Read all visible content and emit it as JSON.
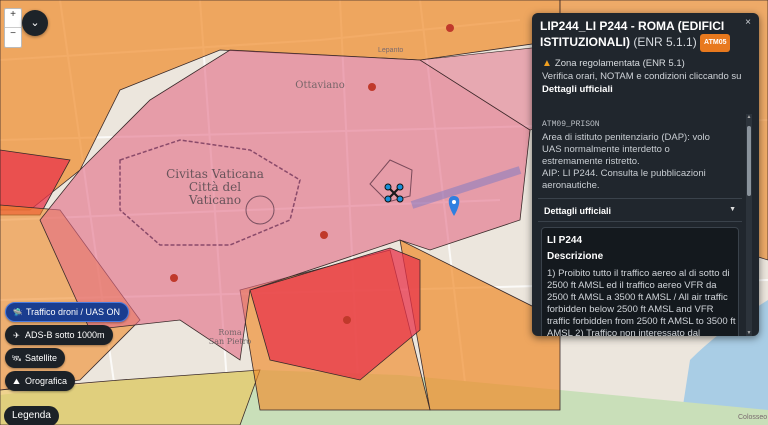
{
  "map": {
    "labels": {
      "citta_vaticano": "Civitas Vaticana\nCittà del\nVaticano",
      "ottaviano": "Ottaviano",
      "roma": "Roma\nSan Pietro",
      "colosseo": "Colosseo",
      "lepanto": "Lepanto"
    },
    "zoom_in": "+",
    "zoom_out": "−",
    "collapse_icon": "chevron-down-icon"
  },
  "layers": [
    {
      "label": "Traffico droni / UAS ON",
      "icon": "🛸",
      "active": true
    },
    {
      "label": "ADS-B sotto 1000m",
      "icon": "✈",
      "active": false
    },
    {
      "label": "Satellite",
      "icon": "🛰",
      "active": false
    },
    {
      "label": "Orografica",
      "icon": "⛰",
      "active": false
    }
  ],
  "legend_label": "Legenda",
  "panel": {
    "title": "LIP244_LI P244 - ROMA (EDIFICI ISTITUZIONALI)",
    "title_sub": "(ENR 5.1.1)",
    "badge": "ATM05",
    "close": "×",
    "warning": "Zona regolamentata (ENR 5.1)",
    "info": "Verifica orari, NOTAM e condizioni cliccando su",
    "info_bold": "Dettagli ufficiali",
    "code": "ATM09_PRISON",
    "desc": "Area di istituto penitenziario (DAP): volo UAS normalmente interdetto o estremamente ristretto.",
    "desc2": "AIP: LI P244. Consulta le pubblicazioni aeronautiche.",
    "details_label": "Dettagli ufficiali",
    "details_caret": "▼",
    "detail_code": "LI P244",
    "detail_heading": "Descrizione",
    "detail_text": "1) Proibito tutto il traffico aereo al di sotto di 2500 ft AMSL ed il traffico aereo VFR da 2500 ft AMSL a 3500 ft AMSL / All air traffic forbidden below 2500 ft AMSL and VFR traffic forbidden from 2500 ft AMSL to 3500 ft AMSL 2) Traffico non interessato dal"
  },
  "colors": {
    "panel_bg": "#20262d",
    "badge": "#e8791e",
    "active_layer": "#1a3d8f",
    "zone_red": "#e8334a",
    "zone_orange": "#f08a2a",
    "zone_pink": "#e26a86"
  }
}
